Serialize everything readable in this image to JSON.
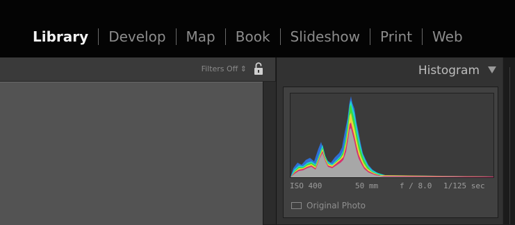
{
  "modules": [
    {
      "label": "Library",
      "active": true
    },
    {
      "label": "Develop",
      "active": false
    },
    {
      "label": "Map",
      "active": false
    },
    {
      "label": "Book",
      "active": false
    },
    {
      "label": "Slideshow",
      "active": false
    },
    {
      "label": "Print",
      "active": false
    },
    {
      "label": "Web",
      "active": false
    }
  ],
  "filter_bar": {
    "label": "Filters Off",
    "caret": "⇕",
    "lock_icon": "lock-open-icon"
  },
  "panel": {
    "title": "Histogram",
    "collapse_icon": "triangle-down-icon"
  },
  "histogram": {
    "iso": "ISO 400",
    "focal": "50 mm",
    "aperture": "f / 8.0",
    "shutter": "1/125 sec",
    "original_photo_label": "Original Photo",
    "original_photo_checked": false
  },
  "colors": {
    "active_module": "#f2f2f2",
    "inactive_module": "#8c8c8c",
    "panel_bg": "#323232",
    "grid_bg": "#535353"
  }
}
